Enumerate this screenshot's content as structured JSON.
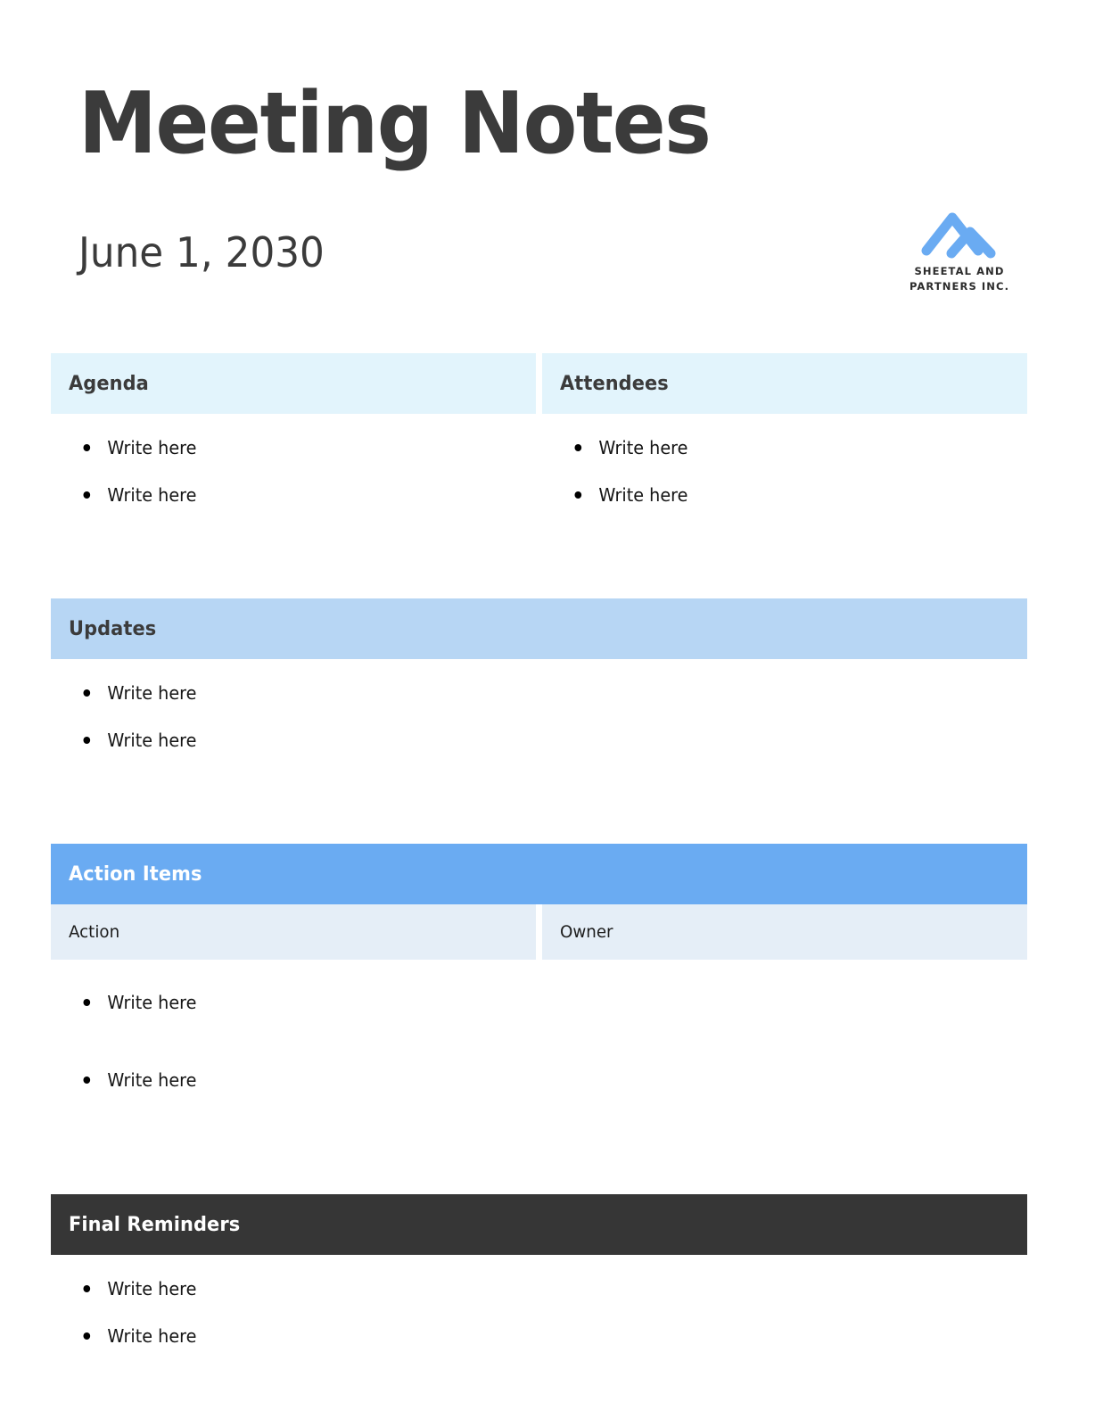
{
  "document": {
    "title": "Meeting Notes",
    "date": "June 1, 2030"
  },
  "logo": {
    "icon": "double-chevron-logo-icon",
    "line1": "SHEETAL AND",
    "line2": "PARTNERS INC."
  },
  "colors": {
    "page_background": "#ffffff",
    "title_text": "#3b3b3b",
    "header_pale_blue": "#e2f4fc",
    "header_light_blue": "#b7d6f4",
    "header_medium_blue": "#6aabf2",
    "subheader_blue_gray": "#e5eef7",
    "header_dark": "#363636",
    "logo_blue": "#6aabf2",
    "bullet_text": "#161616"
  },
  "sections": {
    "agenda": {
      "title": "Agenda",
      "items": [
        "Write here",
        "Write here"
      ]
    },
    "attendees": {
      "title": "Attendees",
      "items": [
        "Write here",
        "Write here"
      ]
    },
    "updates": {
      "title": "Updates",
      "items": [
        "Write here",
        "Write here"
      ]
    },
    "action_items": {
      "title": "Action Items",
      "columns": [
        "Action",
        "Owner"
      ],
      "action_items": [
        "Write here",
        "Write here"
      ],
      "owner_items": []
    },
    "final_reminders": {
      "title": "Final Reminders",
      "items": [
        "Write here",
        "Write here"
      ]
    }
  }
}
